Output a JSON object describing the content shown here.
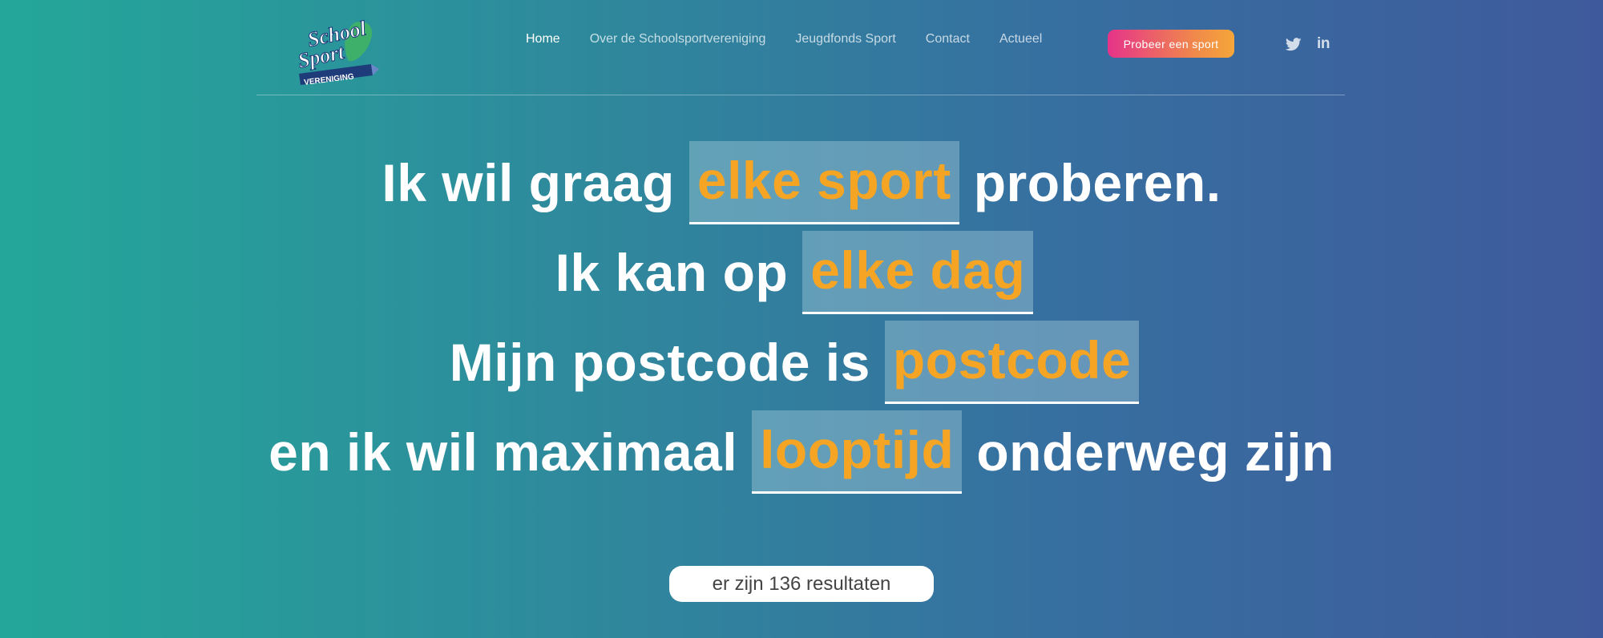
{
  "header": {
    "logo_text": [
      "School",
      "Sport",
      "VERENIGING"
    ],
    "nav": [
      {
        "label": "Home",
        "active": true
      },
      {
        "label": "Over de Schoolsportvereniging",
        "active": false
      },
      {
        "label": "Jeugdfonds Sport",
        "active": false
      },
      {
        "label": "Contact",
        "active": false
      },
      {
        "label": "Actueel",
        "active": false
      }
    ],
    "cta_label": "Probeer een sport",
    "social": [
      "twitter-icon",
      "linkedin-icon"
    ],
    "linkedin_glyph": "in"
  },
  "search": {
    "line1": {
      "before": "Ik wil graag",
      "slot": "elke sport",
      "after": "proberen."
    },
    "line2": {
      "before": "Ik kan op",
      "slot": "elke dag",
      "after": ""
    },
    "line3": {
      "before": "Mijn postcode is",
      "slot": "postcode",
      "after": ""
    },
    "line4": {
      "before": "en ik wil maximaal",
      "slot": "looptijd",
      "after": "onderweg zijn"
    }
  },
  "results_label": "er zijn 136 resultaten",
  "colors": {
    "accent_orange": "#f5a523",
    "cta_start": "#e6338a",
    "cta_end": "#f6a63a",
    "bg_left": "#24a79a",
    "bg_right": "#3f5a9c"
  }
}
